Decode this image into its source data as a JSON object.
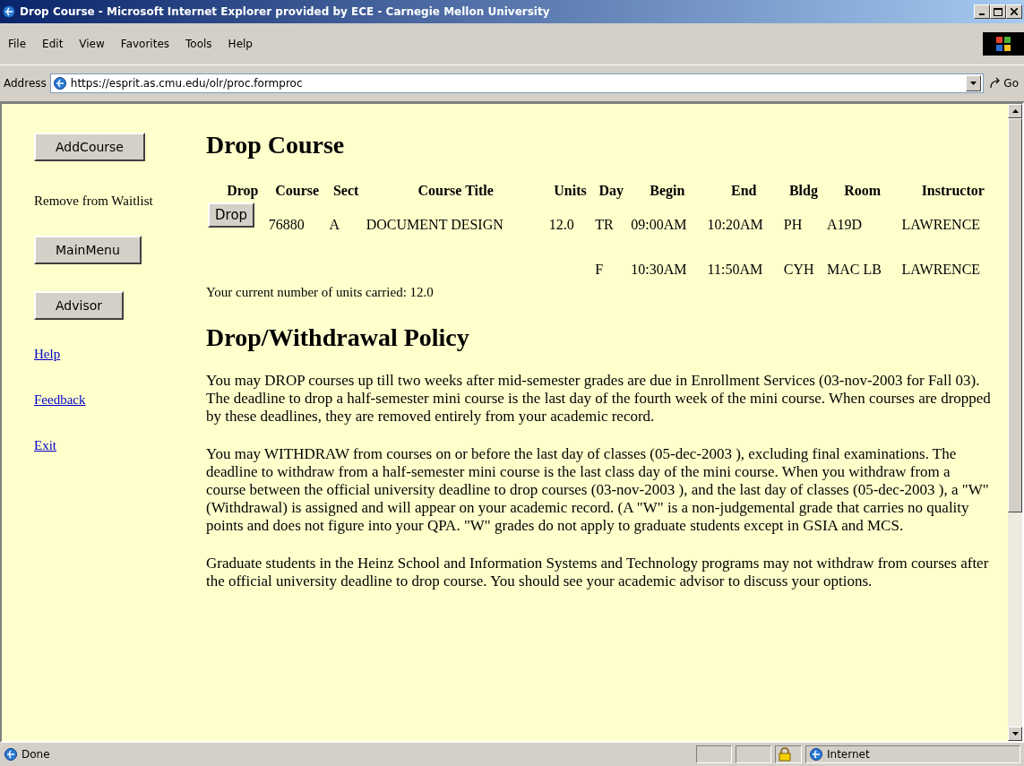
{
  "window": {
    "title": "Drop Course - Microsoft Internet Explorer provided by ECE - Carnegie Mellon University"
  },
  "menu": [
    "File",
    "Edit",
    "View",
    "Favorites",
    "Tools",
    "Help"
  ],
  "address_bar": {
    "label": "Address",
    "value": "https://esprit.as.cmu.edu/olr/proc.formproc",
    "go": "Go"
  },
  "sidebar": [
    {
      "kind": "button",
      "label": "AddCourse"
    },
    {
      "kind": "text",
      "label": "Remove from Waitlist"
    },
    {
      "kind": "button",
      "label": "MainMenu"
    },
    {
      "kind": "button",
      "label": "Advisor"
    },
    {
      "kind": "link",
      "label": "Help"
    },
    {
      "kind": "link",
      "label": "Feedback"
    },
    {
      "kind": "link",
      "label": "Exit"
    }
  ],
  "heading": "Drop Course",
  "table": {
    "columns": [
      "Drop",
      "Course",
      "Sect",
      "Course Title",
      "Units",
      "Day",
      "Begin",
      "End",
      "Bldg",
      "Room",
      "Instructor"
    ],
    "rows": [
      {
        "cells": [
          "Drop",
          "76880",
          "A",
          "DOCUMENT DESIGN",
          "12.0",
          "TR",
          "09:00AM",
          "10:20AM",
          "PH",
          "A19D",
          "LAWRENCE"
        ]
      },
      {
        "cells": [
          "",
          "",
          "",
          "",
          "",
          "F",
          "10:30AM",
          "11:50AM",
          "CYH",
          "MAC LB",
          "LAWRENCE"
        ]
      }
    ]
  },
  "units_note": "Your current number of units carried: 12.0",
  "policy_heading": "Drop/Withdrawal Policy",
  "paragraphs": [
    "You may DROP courses up till two weeks after mid-semester grades are due in Enrollment Services (03-nov-2003 for Fall 03). The deadline to drop a half-semester mini course is the last day of the fourth week of the mini course. When courses are dropped by these deadlines, they are removed entirely from your academic record.",
    "You may WITHDRAW from courses on or before the last day of classes (05-dec-2003 ), excluding final examinations. The deadline to withdraw from a half-semester mini course is the last class day of the mini course. When you withdraw from a course between the official university deadline to drop courses (03-nov-2003 ), and the last day of classes (05-dec-2003 ), a \"W\" (Withdrawal) is assigned and will appear on your academic record. (A \"W\" is a non-judgemental grade that carries no quality points and does not figure into your QPA. \"W\" grades do not apply to graduate students except in GSIA and MCS.",
    "Graduate students in the Heinz School and Information Systems and Technology programs may not withdraw from courses after the official university deadline to drop course. You should see your academic advisor to discuss your options."
  ],
  "status_bar": {
    "text": "Done",
    "zone": "Internet"
  }
}
